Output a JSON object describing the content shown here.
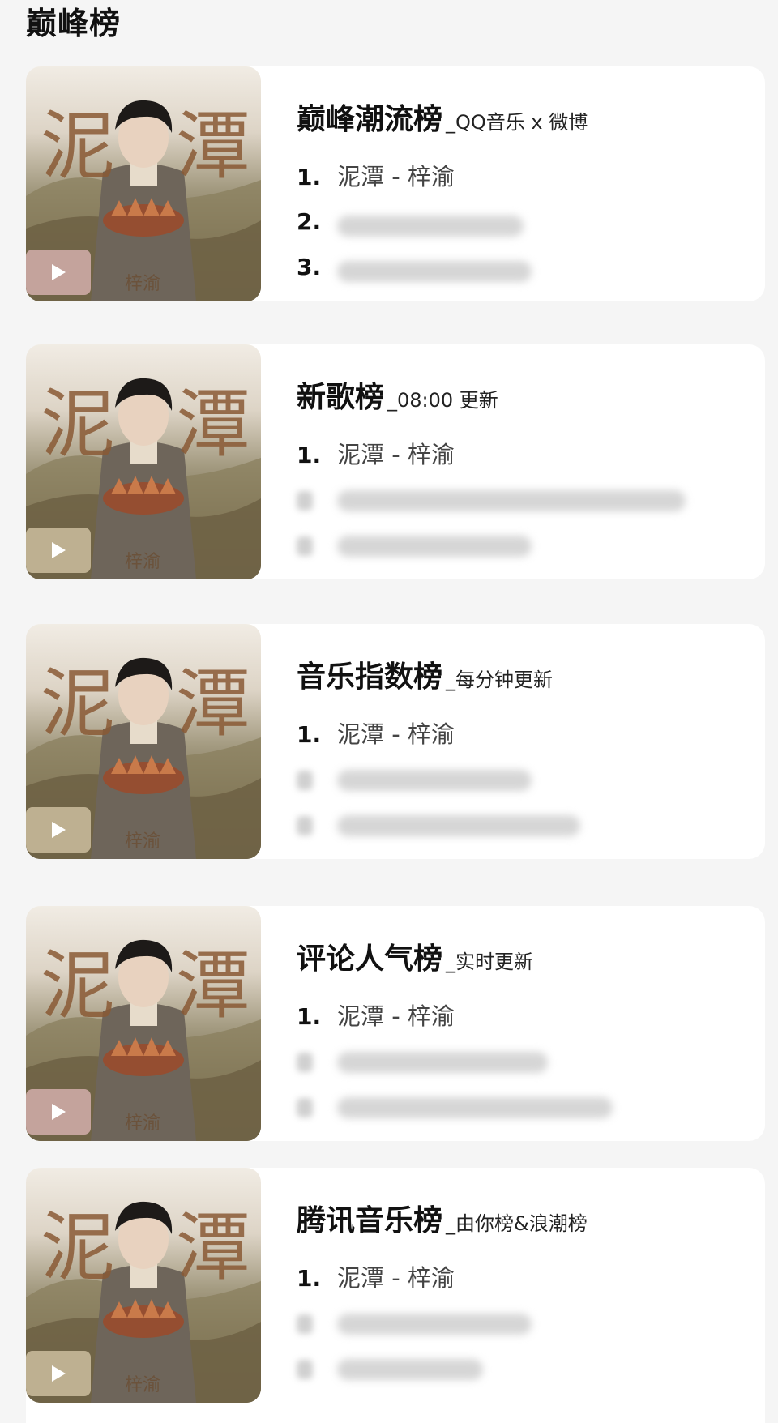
{
  "page": {
    "title": "巅峰榜"
  },
  "cover": {
    "calligraphy_left": "泥",
    "calligraphy_right": "潭",
    "signature": "梓渝"
  },
  "charts": [
    {
      "name": "巅峰潮流榜",
      "subtitle": "_QQ音乐 x 微博",
      "tracks": [
        {
          "rank": "1.",
          "text": "泥潭 - 梓渝"
        },
        {
          "rank": "2.",
          "text": ""
        },
        {
          "rank": "3.",
          "text": ""
        }
      ]
    },
    {
      "name": "新歌榜",
      "subtitle": "_08:00 更新",
      "tracks": [
        {
          "rank": "1.",
          "text": "泥潭 - 梓渝"
        },
        {
          "rank": "",
          "text": ""
        },
        {
          "rank": "",
          "text": ""
        }
      ]
    },
    {
      "name": "音乐指数榜",
      "subtitle": "_每分钟更新",
      "tracks": [
        {
          "rank": "1.",
          "text": "泥潭 - 梓渝"
        },
        {
          "rank": "",
          "text": ""
        },
        {
          "rank": "",
          "text": ""
        }
      ]
    },
    {
      "name": "评论人气榜",
      "subtitle": "_实时更新",
      "tracks": [
        {
          "rank": "1.",
          "text": "泥潭 - 梓渝"
        },
        {
          "rank": "",
          "text": ""
        },
        {
          "rank": "",
          "text": ""
        }
      ]
    },
    {
      "name": "腾讯音乐榜",
      "subtitle": "_由你榜&浪潮榜",
      "tracks": [
        {
          "rank": "1.",
          "text": "泥潭 - 梓渝"
        },
        {
          "rank": "",
          "text": ""
        },
        {
          "rank": "",
          "text": ""
        }
      ]
    }
  ],
  "colors": {
    "page_bg": "#f5f5f5",
    "card_bg": "#ffffff",
    "title_text": "#111111",
    "track_text": "#444444",
    "play_button_pink": "#cdaaa5",
    "play_button_tan": "#c4b698",
    "blur_placeholder": "#d6d6d6"
  },
  "icons": {
    "play": "play-icon"
  }
}
